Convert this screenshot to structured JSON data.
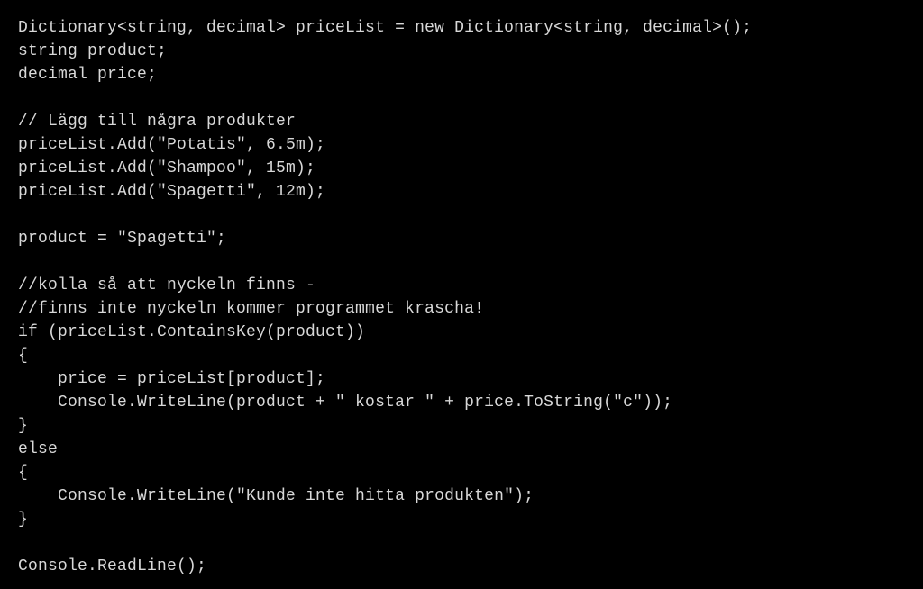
{
  "code": {
    "lines": [
      "Dictionary<string, decimal> priceList = new Dictionary<string, decimal>();",
      "string product;",
      "decimal price;",
      "",
      "// Lägg till några produkter",
      "priceList.Add(\"Potatis\", 6.5m);",
      "priceList.Add(\"Shampoo\", 15m);",
      "priceList.Add(\"Spagetti\", 12m);",
      "",
      "product = \"Spagetti\";",
      "",
      "//kolla så att nyckeln finns -",
      "//finns inte nyckeln kommer programmet krascha!",
      "if (priceList.ContainsKey(product))",
      "{",
      "    price = priceList[product];",
      "    Console.WriteLine(product + \" kostar \" + price.ToString(\"c\"));",
      "}",
      "else",
      "{",
      "    Console.WriteLine(\"Kunde inte hitta produkten\");",
      "}",
      "",
      "Console.ReadLine();"
    ]
  }
}
